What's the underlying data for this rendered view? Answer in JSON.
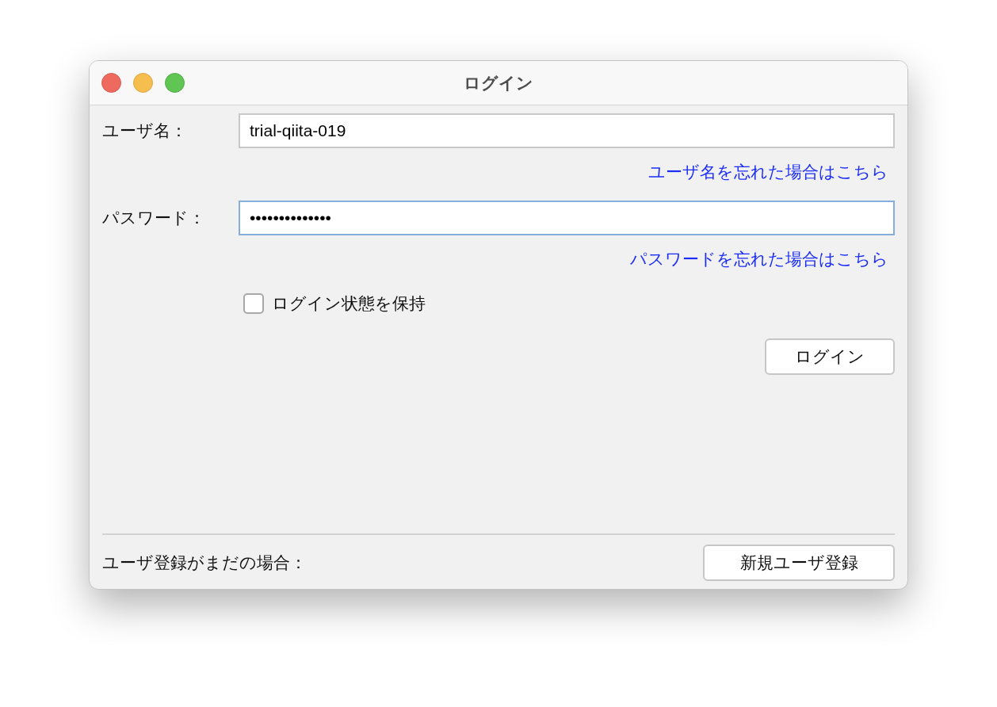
{
  "window": {
    "title": "ログイン"
  },
  "username": {
    "label": "ユーザ名：",
    "value": "trial-qiita-019",
    "focused": false
  },
  "username_link": "ユーザ名を忘れた場合はこちら",
  "password": {
    "label": "パスワード：",
    "value": "••••••••••••••",
    "focused": true
  },
  "password_link": "パスワードを忘れた場合はこちら",
  "remember": {
    "label": "ログイン状態を保持",
    "checked": false
  },
  "login_button": "ログイン",
  "footer": {
    "text": "ユーザ登録がまだの場合：",
    "button": "新規ユーザ登録"
  }
}
